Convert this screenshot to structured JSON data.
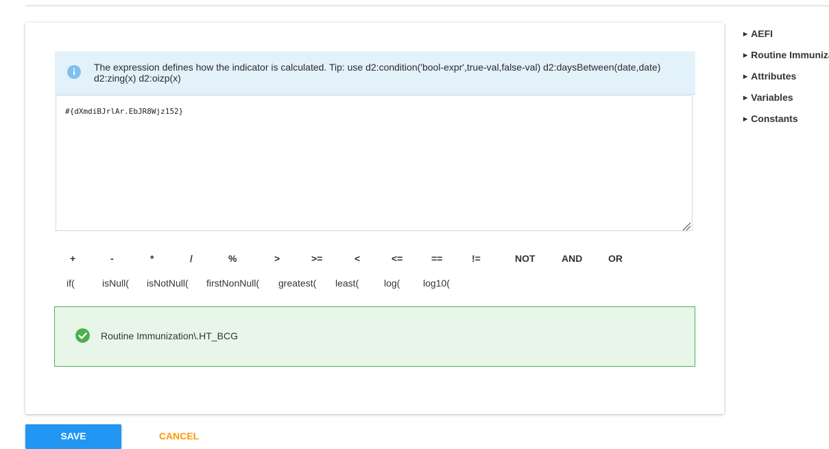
{
  "info": {
    "icon": "info-icon",
    "text": "The expression defines how the indicator is calculated. Tip: use d2:condition('bool-expr',true-val,false-val) d2:daysBetween(date,date) d2:zing(x) d2:oizp(x)"
  },
  "expression": {
    "value": "#{dXmdiBJrlAr.EbJR8Wjz152}"
  },
  "operators": [
    "+",
    "-",
    "*",
    "/",
    "%",
    ">",
    ">=",
    "<",
    "<=",
    "==",
    "!=",
    "NOT",
    "AND",
    "OR"
  ],
  "functions": [
    "if(",
    "isNull(",
    "isNotNull(",
    "firstNonNull(",
    "greatest(",
    "least(",
    "log(",
    "log10("
  ],
  "validation": {
    "icon": "check-circle-icon",
    "status_color": "#4caf50",
    "text": "Routine Immunization\\.HT_BCG"
  },
  "sidebar": {
    "items": [
      {
        "label": "AEFI"
      },
      {
        "label": "Routine Immunization"
      },
      {
        "label": "Attributes"
      },
      {
        "label": "Variables"
      },
      {
        "label": "Constants"
      }
    ]
  },
  "actions": {
    "save_label": "SAVE",
    "cancel_label": "CANCEL",
    "save_color": "#2196f3",
    "cancel_color": "#ff9800"
  }
}
